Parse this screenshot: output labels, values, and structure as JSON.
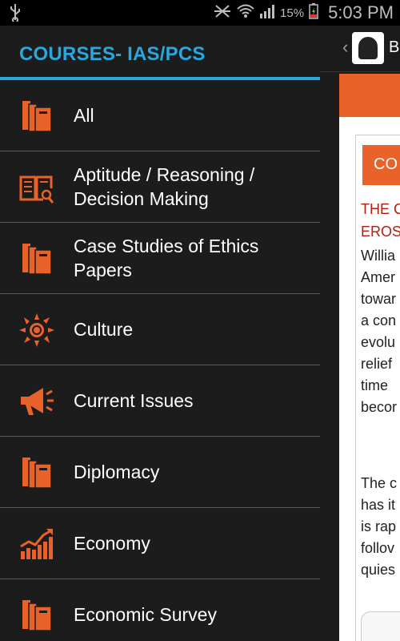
{
  "status_bar": {
    "battery_percent": "15%",
    "time": "5:03 PM"
  },
  "drawer": {
    "title": "COURSES- IAS/PCS",
    "items": [
      {
        "label": "All",
        "icon": "books-icon"
      },
      {
        "label": "Aptitude / Reasoning / Decision Making",
        "icon": "book-search-icon"
      },
      {
        "label": "Case Studies of Ethics Papers",
        "icon": "books-icon"
      },
      {
        "label": "Culture",
        "icon": "sun-icon"
      },
      {
        "label": "Current Issues",
        "icon": "megaphone-icon"
      },
      {
        "label": "Diplomacy",
        "icon": "books-icon"
      },
      {
        "label": "Economy",
        "icon": "chart-icon"
      },
      {
        "label": "Economic Survey",
        "icon": "books-icon"
      }
    ]
  },
  "background_app": {
    "title_fragment": "B",
    "card_heading_fragment": "CO",
    "red_lines": [
      "THE C",
      "EROS"
    ],
    "paragraph1": [
      "Willia",
      "Amer",
      "towar",
      "a con",
      "evolu",
      "relief",
      "time",
      "becor"
    ],
    "paragraph2": [
      "The c",
      "has it",
      "is rap",
      "follov",
      "quies"
    ]
  },
  "colors": {
    "accent_blue": "#2aa8dd",
    "accent_orange": "#e8622a",
    "drawer_bg": "#1c1c1c"
  }
}
